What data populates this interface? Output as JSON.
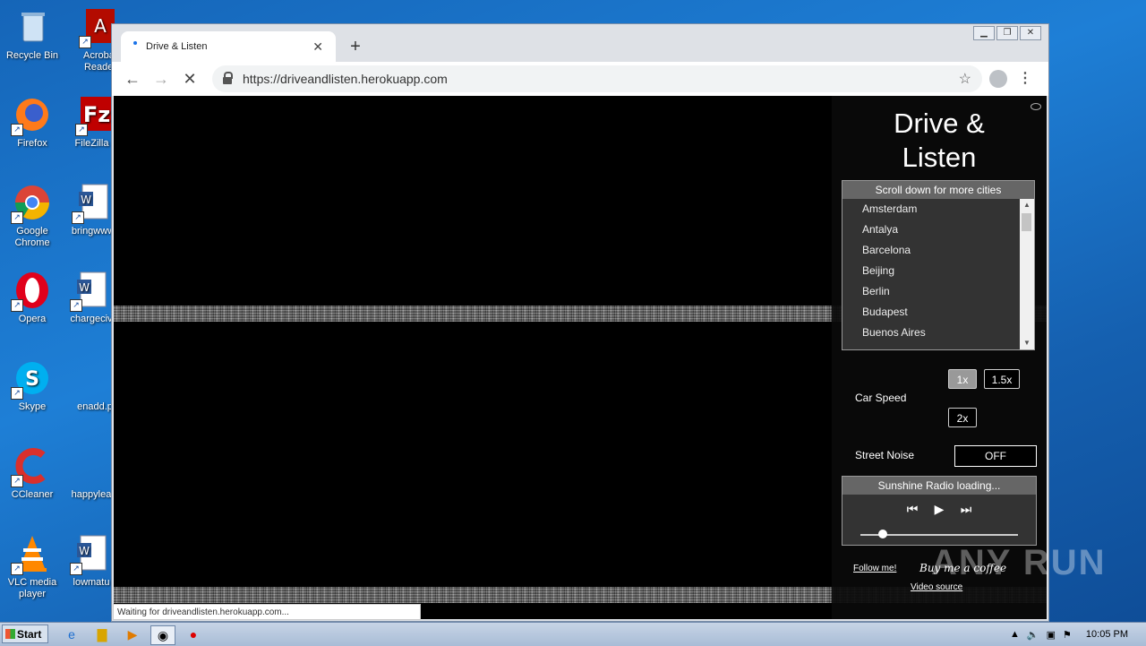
{
  "desktop_icons": [
    {
      "label": "Recycle Bin",
      "icon": "recycle-bin-icon"
    },
    {
      "label": "Acrobat Reader",
      "icon": "acrobat-icon"
    },
    {
      "label": "Firefox",
      "icon": "firefox-icon"
    },
    {
      "label": "FileZilla C",
      "icon": "filezilla-icon"
    },
    {
      "label": "Google Chrome",
      "icon": "chrome-icon"
    },
    {
      "label": "bringwww",
      "icon": "word-doc-icon"
    },
    {
      "label": "Opera",
      "icon": "opera-icon"
    },
    {
      "label": "chargeciv",
      "icon": "word-doc-icon"
    },
    {
      "label": "Skype",
      "icon": "skype-icon"
    },
    {
      "label": "enadd.p",
      "icon": "file-icon"
    },
    {
      "label": "CCleaner",
      "icon": "ccleaner-icon"
    },
    {
      "label": "happylea",
      "icon": "file-icon"
    },
    {
      "label": "VLC media player",
      "icon": "vlc-icon"
    },
    {
      "label": "lowmatu",
      "icon": "word-doc-icon"
    }
  ],
  "browser": {
    "tab_title": "Drive & Listen",
    "new_tab": "+",
    "url": "https://driveandlisten.herokuapp.com",
    "status": "Waiting for driveandlisten.herokuapp.com..."
  },
  "app": {
    "title": "Drive &\nListen",
    "cities_header": "Scroll down for more cities",
    "cities": [
      "Amsterdam",
      "Antalya",
      "Barcelona",
      "Beijing",
      "Berlin",
      "Budapest",
      "Buenos Aires"
    ],
    "car_speed_label": "Car Speed",
    "speeds": [
      "1x",
      "1.5x",
      "2x"
    ],
    "selected_speed": "1x",
    "street_noise_label": "Street Noise",
    "street_noise_value": "OFF",
    "radio_header": "Sunshine Radio loading...",
    "volume_fraction": 0.14,
    "follow": "Follow me!",
    "coffee": "Buy me a coffee",
    "video_source": "Video source"
  },
  "watermark": "ANY RUN",
  "taskbar": {
    "start": "Start",
    "clock": "10:05 PM"
  }
}
